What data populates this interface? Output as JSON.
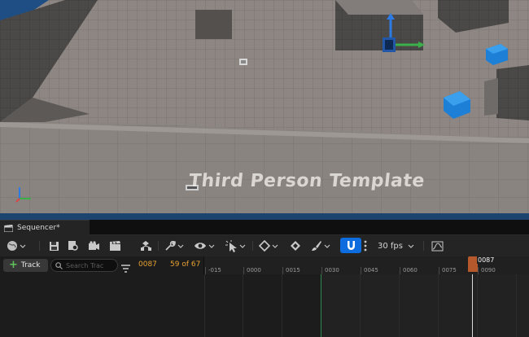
{
  "viewport": {
    "overlay_text": "Third Person Template"
  },
  "tabs": [
    {
      "label": "Sequencer*",
      "icon": "clapperboard-icon"
    }
  ],
  "toolbar": {
    "snap_active": true,
    "snap_color": "#0d6cde",
    "fps_label": "30 fps",
    "buttons": [
      "world-icon",
      "save-icon",
      "find-asset-icon",
      "render-movie-icon",
      "cinematic-icon",
      "actor-hierarchy-icon",
      "wrench-icon",
      "visibility-icon",
      "select-cursor-icon",
      "keyframe-icon",
      "auto-key-icon",
      "brush-icon",
      "magnet-icon",
      "more-icon",
      "curve-editor-icon"
    ]
  },
  "sequencer": {
    "add_track_label": "Track",
    "search_placeholder": "Search Trac",
    "current_frame": "0087",
    "frame_count_text": "59 of 67",
    "accent_color": "#e8a332"
  },
  "timeline": {
    "ticks": [
      "-015",
      "0000",
      "0015",
      "0030",
      "0045",
      "0060",
      "0075",
      "0090"
    ],
    "playhead_label": "0087",
    "playhead_color": "#b5582c"
  }
}
